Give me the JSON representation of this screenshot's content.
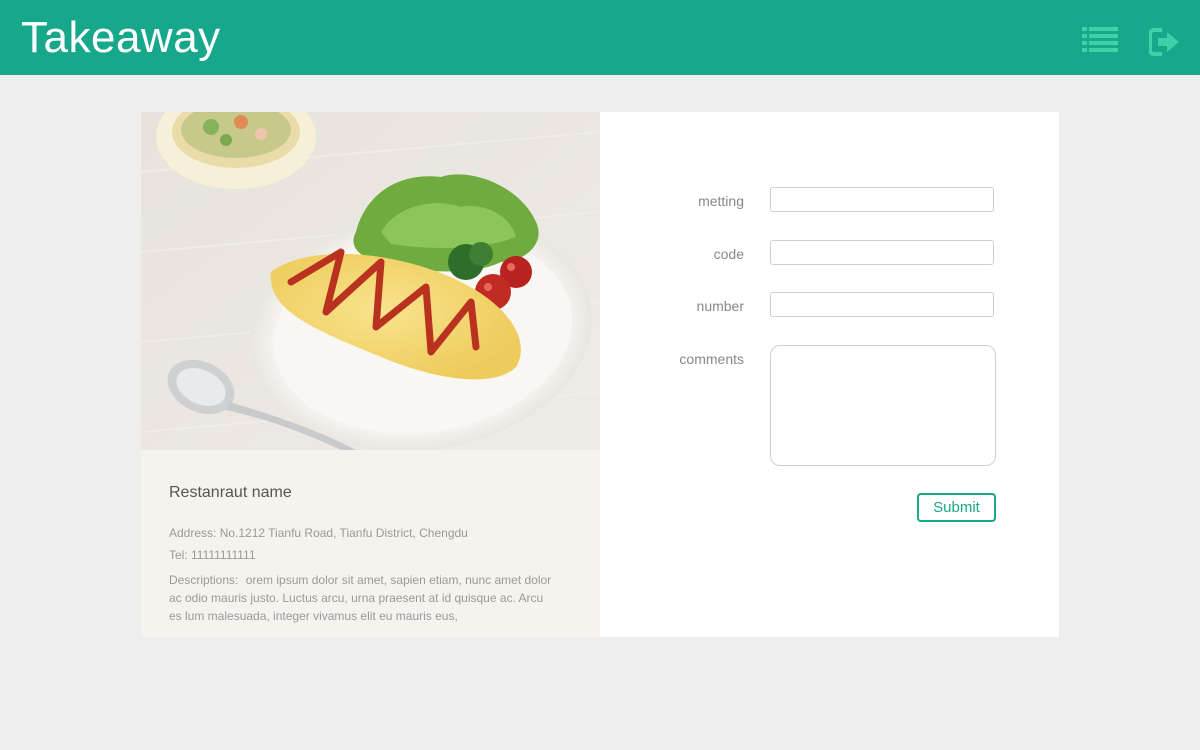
{
  "header": {
    "title": "Takeaway",
    "icons": [
      "list-icon",
      "logout-icon"
    ],
    "bg_color": "#17a78a"
  },
  "restaurant": {
    "name": "Restanraut name",
    "address": "Address: No.1212 Tianfu Road, Tianfu District, Chengdu",
    "tel": "Tel: 11111111111",
    "description_label": "Descriptions:",
    "description": "orem ipsum dolor sit amet, sapien etiam, nunc amet dolor ac odio mauris justo. Luctus arcu, urna praesent at id quisque ac. Arcu es lum malesuada, integer vivamus elit eu mauris eus,",
    "image": "omelette-rice-photo"
  },
  "form": {
    "fields": [
      {
        "label": "metting",
        "value": "",
        "placeholder": ""
      },
      {
        "label": "code",
        "value": "",
        "placeholder": ""
      },
      {
        "label": "number",
        "value": "",
        "placeholder": ""
      }
    ],
    "comments_label": "comments",
    "comments_value": "",
    "submit_label": "Submit"
  },
  "colors": {
    "accent": "#17a78a",
    "page_bg": "#eeeeee",
    "info_bg": "#f6f3ef"
  }
}
